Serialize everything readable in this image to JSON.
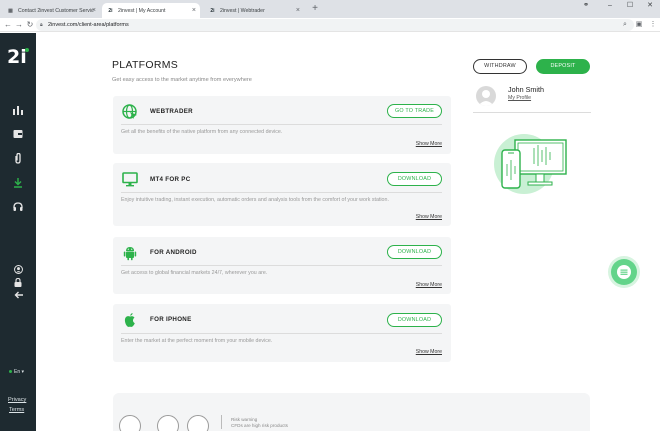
{
  "browser": {
    "tabs": [
      {
        "label": "Contact 2invest Customer Servic",
        "active": false
      },
      {
        "label": "2invest | My Account",
        "active": true
      },
      {
        "label": "2invest | Webtrader",
        "active": false
      }
    ],
    "url": "2invest.com/client-area/platforms"
  },
  "sidebar": {
    "logo": "2i",
    "language": "En ▾",
    "privacy": "Privacy",
    "terms": "Terms",
    "accent_color": "#2db24b"
  },
  "main": {
    "title": "PLATFORMS",
    "subtitle": "Get easy access to the market anytime from everywhere",
    "platforms": [
      {
        "name": "WEBTRADER",
        "button": "GO TO TRADE",
        "description": "Get all the benefits of the native platform from any connected device.",
        "more": "Show More",
        "icon": "globe-cursor-icon"
      },
      {
        "name": "MT4 FOR PC",
        "button": "DOWNLOAD",
        "description": "Enjoy intuitive trading, instant execution, automatic orders and analysis tools from the comfort of your work station.",
        "more": "Show More",
        "icon": "monitor-icon"
      },
      {
        "name": "FOR ANDROID",
        "button": "DOWNLOAD",
        "description": "Get access to global financial markets 24/7, wherever you are.",
        "more": "Show More",
        "icon": "android-icon"
      },
      {
        "name": "FOR IPHONE",
        "button": "DOWNLOAD",
        "description": "Enter the market at the perfect moment from your mobile device.",
        "more": "Show More",
        "icon": "apple-icon"
      }
    ]
  },
  "account": {
    "withdraw": "WITHDRAW",
    "deposit": "DEPOSIT",
    "user_name": "John Smith",
    "profile_link": "My Profile"
  },
  "footer": {
    "risk_title": "Risk warning",
    "risk_text": "CFDs are high risk products"
  }
}
